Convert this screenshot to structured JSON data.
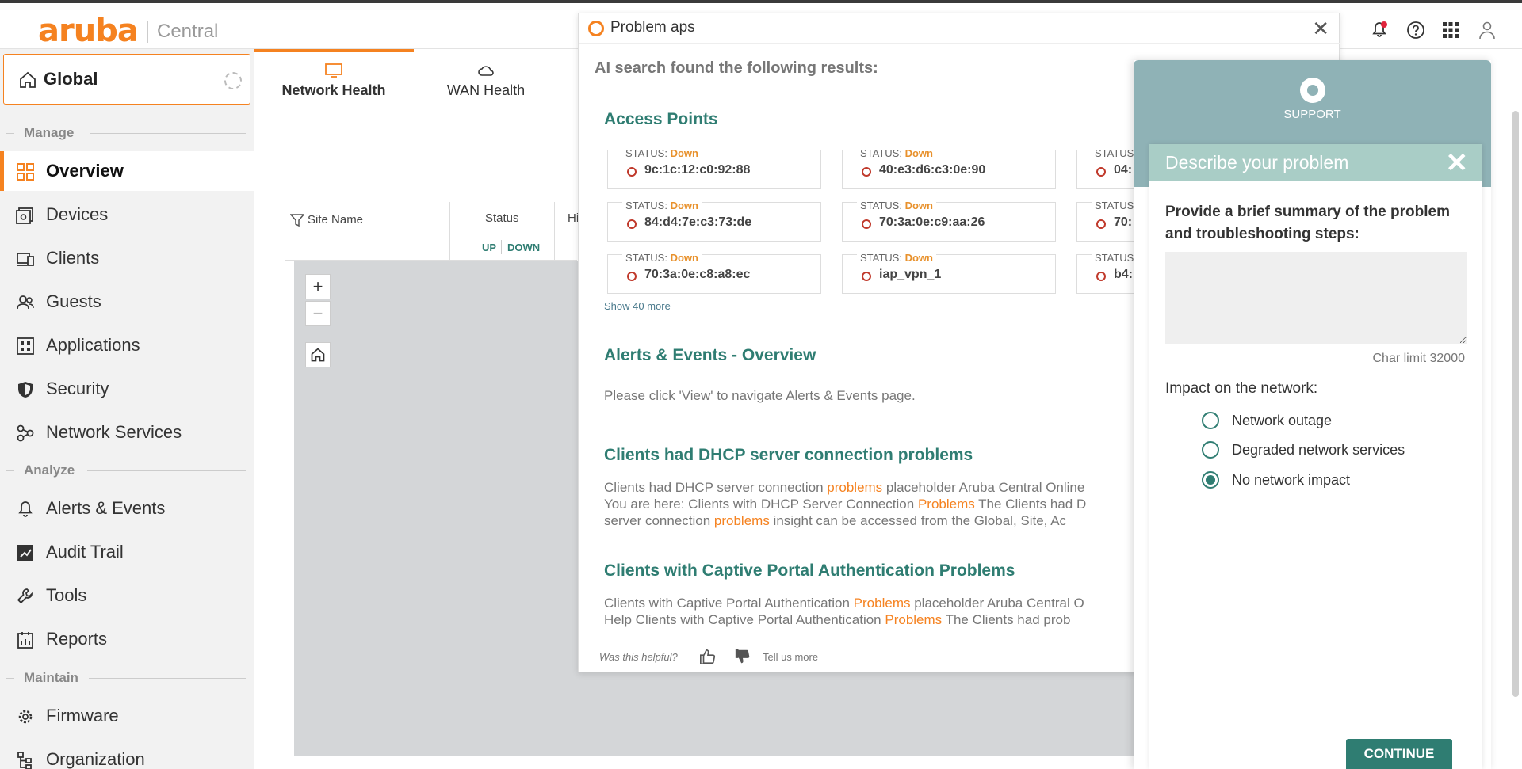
{
  "app": {
    "brand": "aruba",
    "product": "Central"
  },
  "scope": {
    "label": "Global"
  },
  "sidebar": {
    "sections": [
      {
        "title": "Manage"
      },
      {
        "title": "Analyze"
      },
      {
        "title": "Maintain"
      }
    ],
    "items": [
      {
        "label": "Overview"
      },
      {
        "label": "Devices"
      },
      {
        "label": "Clients"
      },
      {
        "label": "Guests"
      },
      {
        "label": "Applications"
      },
      {
        "label": "Security"
      },
      {
        "label": "Network Services"
      },
      {
        "label": "Alerts & Events"
      },
      {
        "label": "Audit Trail"
      },
      {
        "label": "Tools"
      },
      {
        "label": "Reports"
      },
      {
        "label": "Firmware"
      },
      {
        "label": "Organization"
      }
    ]
  },
  "tabs": [
    {
      "label": "Network Health"
    },
    {
      "label": "WAN Health"
    }
  ],
  "table": {
    "col_site": "Site Name",
    "col_status": "Status",
    "status_up": "UP",
    "status_down": "DOWN",
    "col_partial": "Hi"
  },
  "search": {
    "query": "Problem aps",
    "found": "AI search found the following results:",
    "ap_section": "Access Points",
    "status_label": "STATUS:",
    "access_points": [
      {
        "status": "Down",
        "name": "9c:1c:12:c0:92:88"
      },
      {
        "status": "Down",
        "name": "40:e3:d6:c3:0e:90"
      },
      {
        "status": "",
        "name": "04:"
      },
      {
        "status": "Down",
        "name": "84:d4:7e:c3:73:de"
      },
      {
        "status": "Down",
        "name": "70:3a:0e:c9:aa:26"
      },
      {
        "status": "",
        "name": "70:"
      },
      {
        "status": "Down",
        "name": "70:3a:0e:c8:a8:ec"
      },
      {
        "status": "Down",
        "name": "iap_vpn_1"
      },
      {
        "status": "",
        "name": "b4:"
      }
    ],
    "show_more": "Show 40 more",
    "alerts_title": "Alerts & Events - Overview",
    "alerts_text": "Please click 'View' to navigate Alerts & Events page.",
    "dhcp_title": "Clients had DHCP server connection problems",
    "dhcp_lines": [
      [
        "Clients had DHCP server connection ",
        "problems",
        " placeholder Aruba Central Online"
      ],
      [
        "You are here: Clients with DHCP Server Connection ",
        "Problems",
        " The Clients had D"
      ],
      [
        "server connection ",
        "problems",
        " insight can be accessed from the Global, Site, Ac"
      ]
    ],
    "captive_title": "Clients with Captive Portal Authentication Problems",
    "captive_lines": [
      [
        "Clients with Captive Portal Authentication ",
        "Problems",
        " placeholder Aruba Central O"
      ],
      [
        "Help Clients with Captive Portal Authentication ",
        "Problems",
        " The Clients had prob"
      ]
    ],
    "helpful": "Was this helpful?",
    "tell_more": "Tell us more"
  },
  "support": {
    "title": "SUPPORT",
    "card_title": "Describe your problem",
    "prompt": "Provide a brief summary of the problem and troubleshooting steps:",
    "char_limit": "Char limit 32000",
    "impact_label": "Impact on the network:",
    "options": [
      {
        "label": "Network outage",
        "selected": false
      },
      {
        "label": "Degraded network services",
        "selected": false
      },
      {
        "label": "No network impact",
        "selected": true
      }
    ],
    "continue": "CONTINUE"
  },
  "colors": {
    "brand_orange": "#f58220",
    "teal": "#2f7d72",
    "down": "#e8912c"
  }
}
